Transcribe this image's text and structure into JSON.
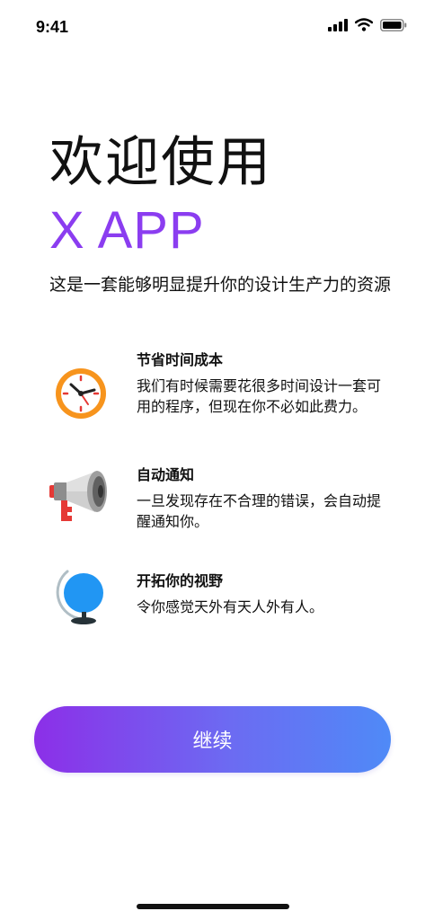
{
  "status_bar": {
    "time": "9:41",
    "icons": [
      "signal-icon",
      "wifi-icon",
      "battery-icon"
    ]
  },
  "welcome_title": "欢迎使用",
  "app_name": "X APP",
  "intro": "这是一套能够明显提升你的设计生产力的资源",
  "features": [
    {
      "icon": "clock-icon",
      "title": "节省时间成本",
      "description": "我们有时候需要花很多时间设计一套可用的程序，但现在你不必如此费力。"
    },
    {
      "icon": "megaphone-icon",
      "title": "自动通知",
      "description": "一旦发现存在不合理的错误，会自动提醒通知你。"
    },
    {
      "icon": "globe-icon",
      "title": "开拓你的视野",
      "description": "令你感觉天外有天人外有人。"
    }
  ],
  "continue_label": "继续",
  "colors": {
    "accent": "#8b3df0",
    "button_gradient_start": "#8c2fe8",
    "button_gradient_end": "#4f8af7"
  }
}
